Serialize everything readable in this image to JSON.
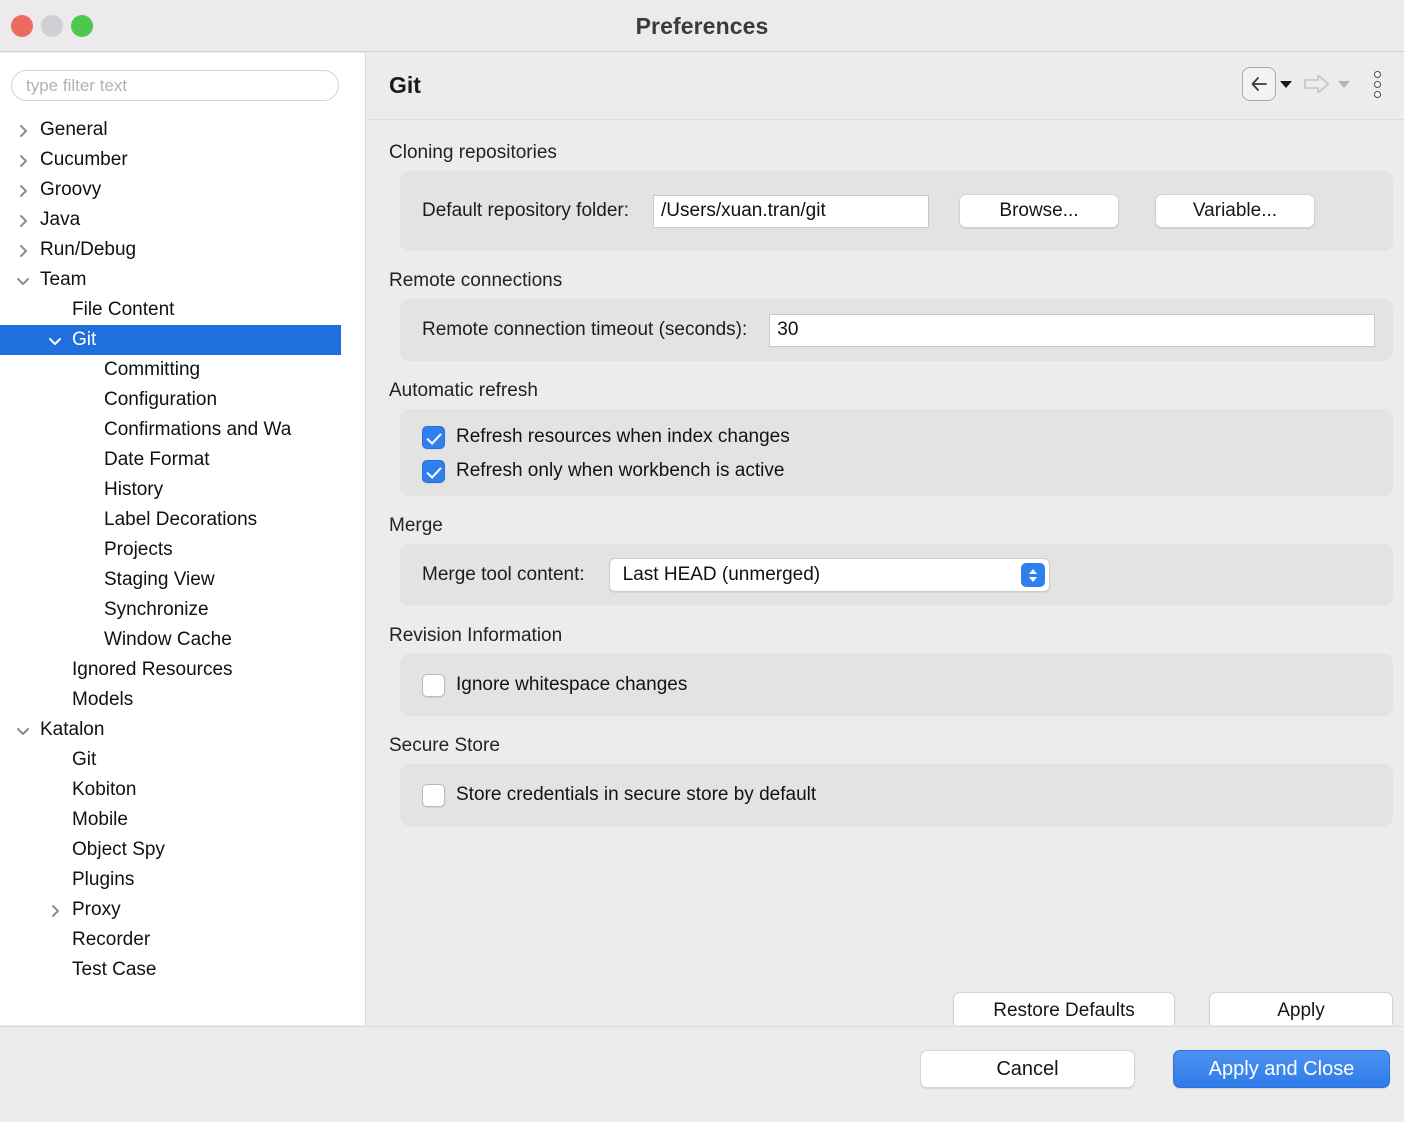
{
  "window": {
    "title": "Preferences",
    "traffic_lights": [
      "close-button",
      "minimize-button",
      "maximize-button"
    ]
  },
  "sidebar": {
    "filter": {
      "placeholder": "type filter text",
      "value": ""
    },
    "items": [
      {
        "label": "General",
        "level": 0,
        "twisty": "collapsed",
        "selected": false
      },
      {
        "label": "Cucumber",
        "level": 0,
        "twisty": "collapsed",
        "selected": false
      },
      {
        "label": "Groovy",
        "level": 0,
        "twisty": "collapsed",
        "selected": false
      },
      {
        "label": "Java",
        "level": 0,
        "twisty": "collapsed",
        "selected": false
      },
      {
        "label": "Run/Debug",
        "level": 0,
        "twisty": "collapsed",
        "selected": false
      },
      {
        "label": "Team",
        "level": 0,
        "twisty": "expanded",
        "selected": false
      },
      {
        "label": "File Content",
        "level": 1,
        "twisty": "none",
        "selected": false
      },
      {
        "label": "Git",
        "level": 1,
        "twisty": "expanded",
        "selected": true
      },
      {
        "label": "Committing",
        "level": 2,
        "twisty": "none",
        "selected": false
      },
      {
        "label": "Configuration",
        "level": 2,
        "twisty": "none",
        "selected": false
      },
      {
        "label": "Confirmations and Wa",
        "level": 2,
        "twisty": "none",
        "selected": false
      },
      {
        "label": "Date Format",
        "level": 2,
        "twisty": "none",
        "selected": false
      },
      {
        "label": "History",
        "level": 2,
        "twisty": "none",
        "selected": false
      },
      {
        "label": "Label Decorations",
        "level": 2,
        "twisty": "none",
        "selected": false
      },
      {
        "label": "Projects",
        "level": 2,
        "twisty": "none",
        "selected": false
      },
      {
        "label": "Staging View",
        "level": 2,
        "twisty": "none",
        "selected": false
      },
      {
        "label": "Synchronize",
        "level": 2,
        "twisty": "none",
        "selected": false
      },
      {
        "label": "Window Cache",
        "level": 2,
        "twisty": "none",
        "selected": false
      },
      {
        "label": "Ignored Resources",
        "level": 1,
        "twisty": "none",
        "selected": false
      },
      {
        "label": "Models",
        "level": 1,
        "twisty": "none",
        "selected": false
      },
      {
        "label": "Katalon",
        "level": 0,
        "twisty": "expanded",
        "selected": false
      },
      {
        "label": "Git",
        "level": 1,
        "twisty": "none",
        "selected": false
      },
      {
        "label": "Kobiton",
        "level": 1,
        "twisty": "none",
        "selected": false
      },
      {
        "label": "Mobile",
        "level": 1,
        "twisty": "none",
        "selected": false
      },
      {
        "label": "Object Spy",
        "level": 1,
        "twisty": "none",
        "selected": false
      },
      {
        "label": "Plugins",
        "level": 1,
        "twisty": "none",
        "selected": false
      },
      {
        "label": "Proxy",
        "level": 1,
        "twisty": "collapsed",
        "selected": false
      },
      {
        "label": "Recorder",
        "level": 1,
        "twisty": "none",
        "selected": false
      },
      {
        "label": "Test Case",
        "level": 1,
        "twisty": "none",
        "selected": false
      }
    ],
    "selected_color": "#1f6fdd"
  },
  "page": {
    "title": "Git",
    "nav": {
      "back_label": "back-arrow",
      "back_menu_label": "back-history-dropdown",
      "forward_label": "forward-arrow",
      "forward_menu_label": "forward-history-dropdown",
      "menu_label": "view-menu"
    },
    "sections": {
      "cloning": {
        "title": "Cloning repositories",
        "folder_label": "Default repository folder:",
        "folder_value": "/Users/xuan.tran/git",
        "browse_label": "Browse...",
        "variable_label": "Variable..."
      },
      "remote": {
        "title": "Remote connections",
        "timeout_label": "Remote connection timeout (seconds):",
        "timeout_value": "30"
      },
      "refresh": {
        "title": "Automatic refresh",
        "option_index_label": "Refresh resources when index changes",
        "option_index_checked": true,
        "option_workbench_label": "Refresh only when workbench is active",
        "option_workbench_checked": true
      },
      "merge": {
        "title": "Merge",
        "tool_label": "Merge tool content:",
        "tool_value": "Last HEAD (unmerged)"
      },
      "revision": {
        "title": "Revision Information",
        "ignore_ws_label": "Ignore whitespace changes",
        "ignore_ws_checked": false
      },
      "secure": {
        "title": "Secure Store",
        "store_creds_label": "Store credentials in secure store by default",
        "store_creds_checked": false
      }
    },
    "actions": {
      "restore_defaults_label": "Restore Defaults",
      "apply_label": "Apply"
    }
  },
  "footer": {
    "cancel_label": "Cancel",
    "apply_close_label": "Apply and Close",
    "accent_color": "#2f7bea"
  }
}
